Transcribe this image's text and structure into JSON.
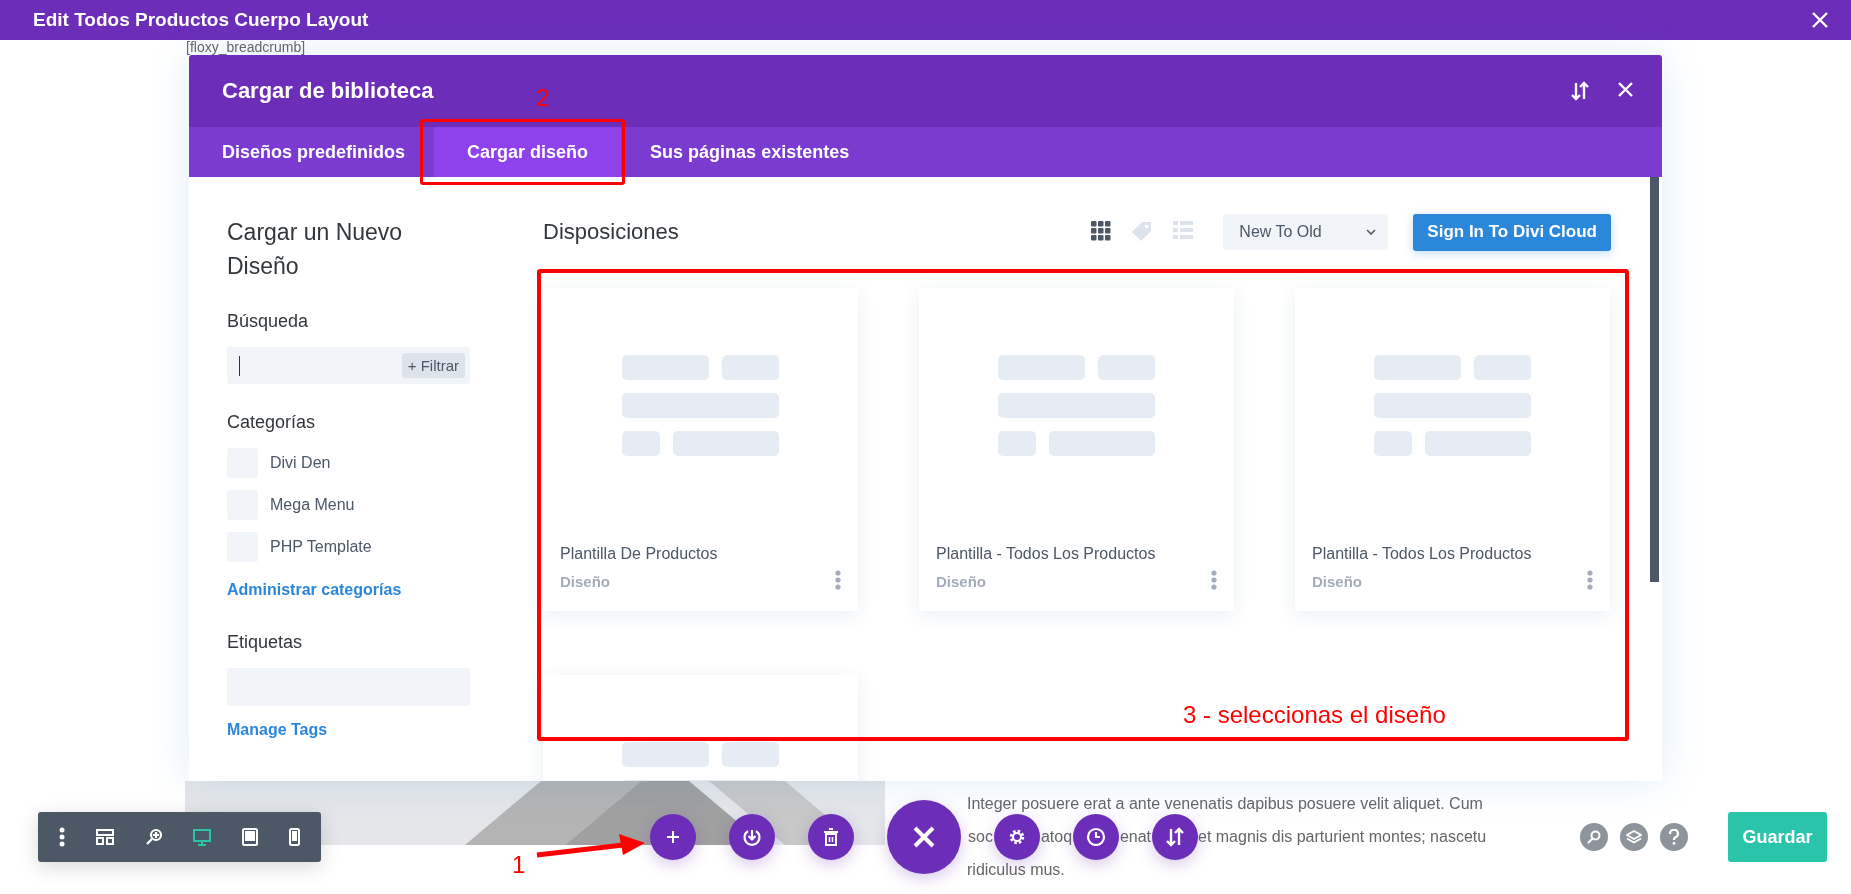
{
  "window": {
    "title": "Edit Todos Productos Cuerpo Layout"
  },
  "page": {
    "shortcode": "[floxy_breadcrumb]",
    "paragraph_lines": [
      [
        "Integer posuere erat a ante venenatis dapibus posuere velit aliquet. Cum"
      ],
      [
        "soc",
        "atoq",
        "enat",
        "et magnis dis parturient montes; nascetu"
      ],
      [
        "ridiculus mus."
      ]
    ]
  },
  "modal": {
    "title": "Cargar de biblioteca",
    "tabs": [
      {
        "label": "Diseños predefinidos",
        "selected": false
      },
      {
        "label": "Cargar diseño",
        "selected": true
      },
      {
        "label": "Sus páginas existentes",
        "selected": false
      }
    ],
    "sidebar": {
      "heading": "Cargar un Nuevo Diseño",
      "search_label": "Búsqueda",
      "filter_button": "+ Filtrar",
      "categories_label": "Categorías",
      "categories": [
        {
          "label": "Divi Den",
          "checked": false
        },
        {
          "label": "Mega Menu",
          "checked": false
        },
        {
          "label": "PHP Template",
          "checked": false
        }
      ],
      "manage_categories_link": "Administrar categorías",
      "tags_label": "Etiquetas",
      "manage_tags_link": "Manage Tags"
    },
    "main": {
      "heading": "Disposiciones",
      "view_modes": [
        {
          "kind": "grid",
          "selected": true
        },
        {
          "kind": "tags",
          "selected": false
        },
        {
          "kind": "list",
          "selected": false
        }
      ],
      "sort_select": "New To Old",
      "sign_in_button": "Sign In To Divi Cloud",
      "layouts": [
        {
          "kind": "full",
          "title": "Plantilla De Productos",
          "type": "Diseño"
        },
        {
          "kind": "full",
          "title": "Plantilla - Todos Los Productos",
          "type": "Diseño"
        },
        {
          "kind": "full",
          "title": "Plantilla - Todos Los Productos",
          "type": "Diseño"
        },
        {
          "kind": "cut"
        }
      ]
    }
  },
  "annotations": {
    "tab_marker": "2",
    "grid_caption": "3 - seleccionas el diseño",
    "add_marker": "1"
  },
  "builder_bar": [
    {
      "kind": "menu",
      "selected": false
    },
    {
      "kind": "wireframe",
      "selected": false
    },
    {
      "kind": "zoom",
      "selected": false
    },
    {
      "kind": "desktop",
      "selected": true
    },
    {
      "kind": "tablet",
      "selected": false
    },
    {
      "kind": "phone",
      "selected": false
    }
  ],
  "save_button": "Guardar"
}
